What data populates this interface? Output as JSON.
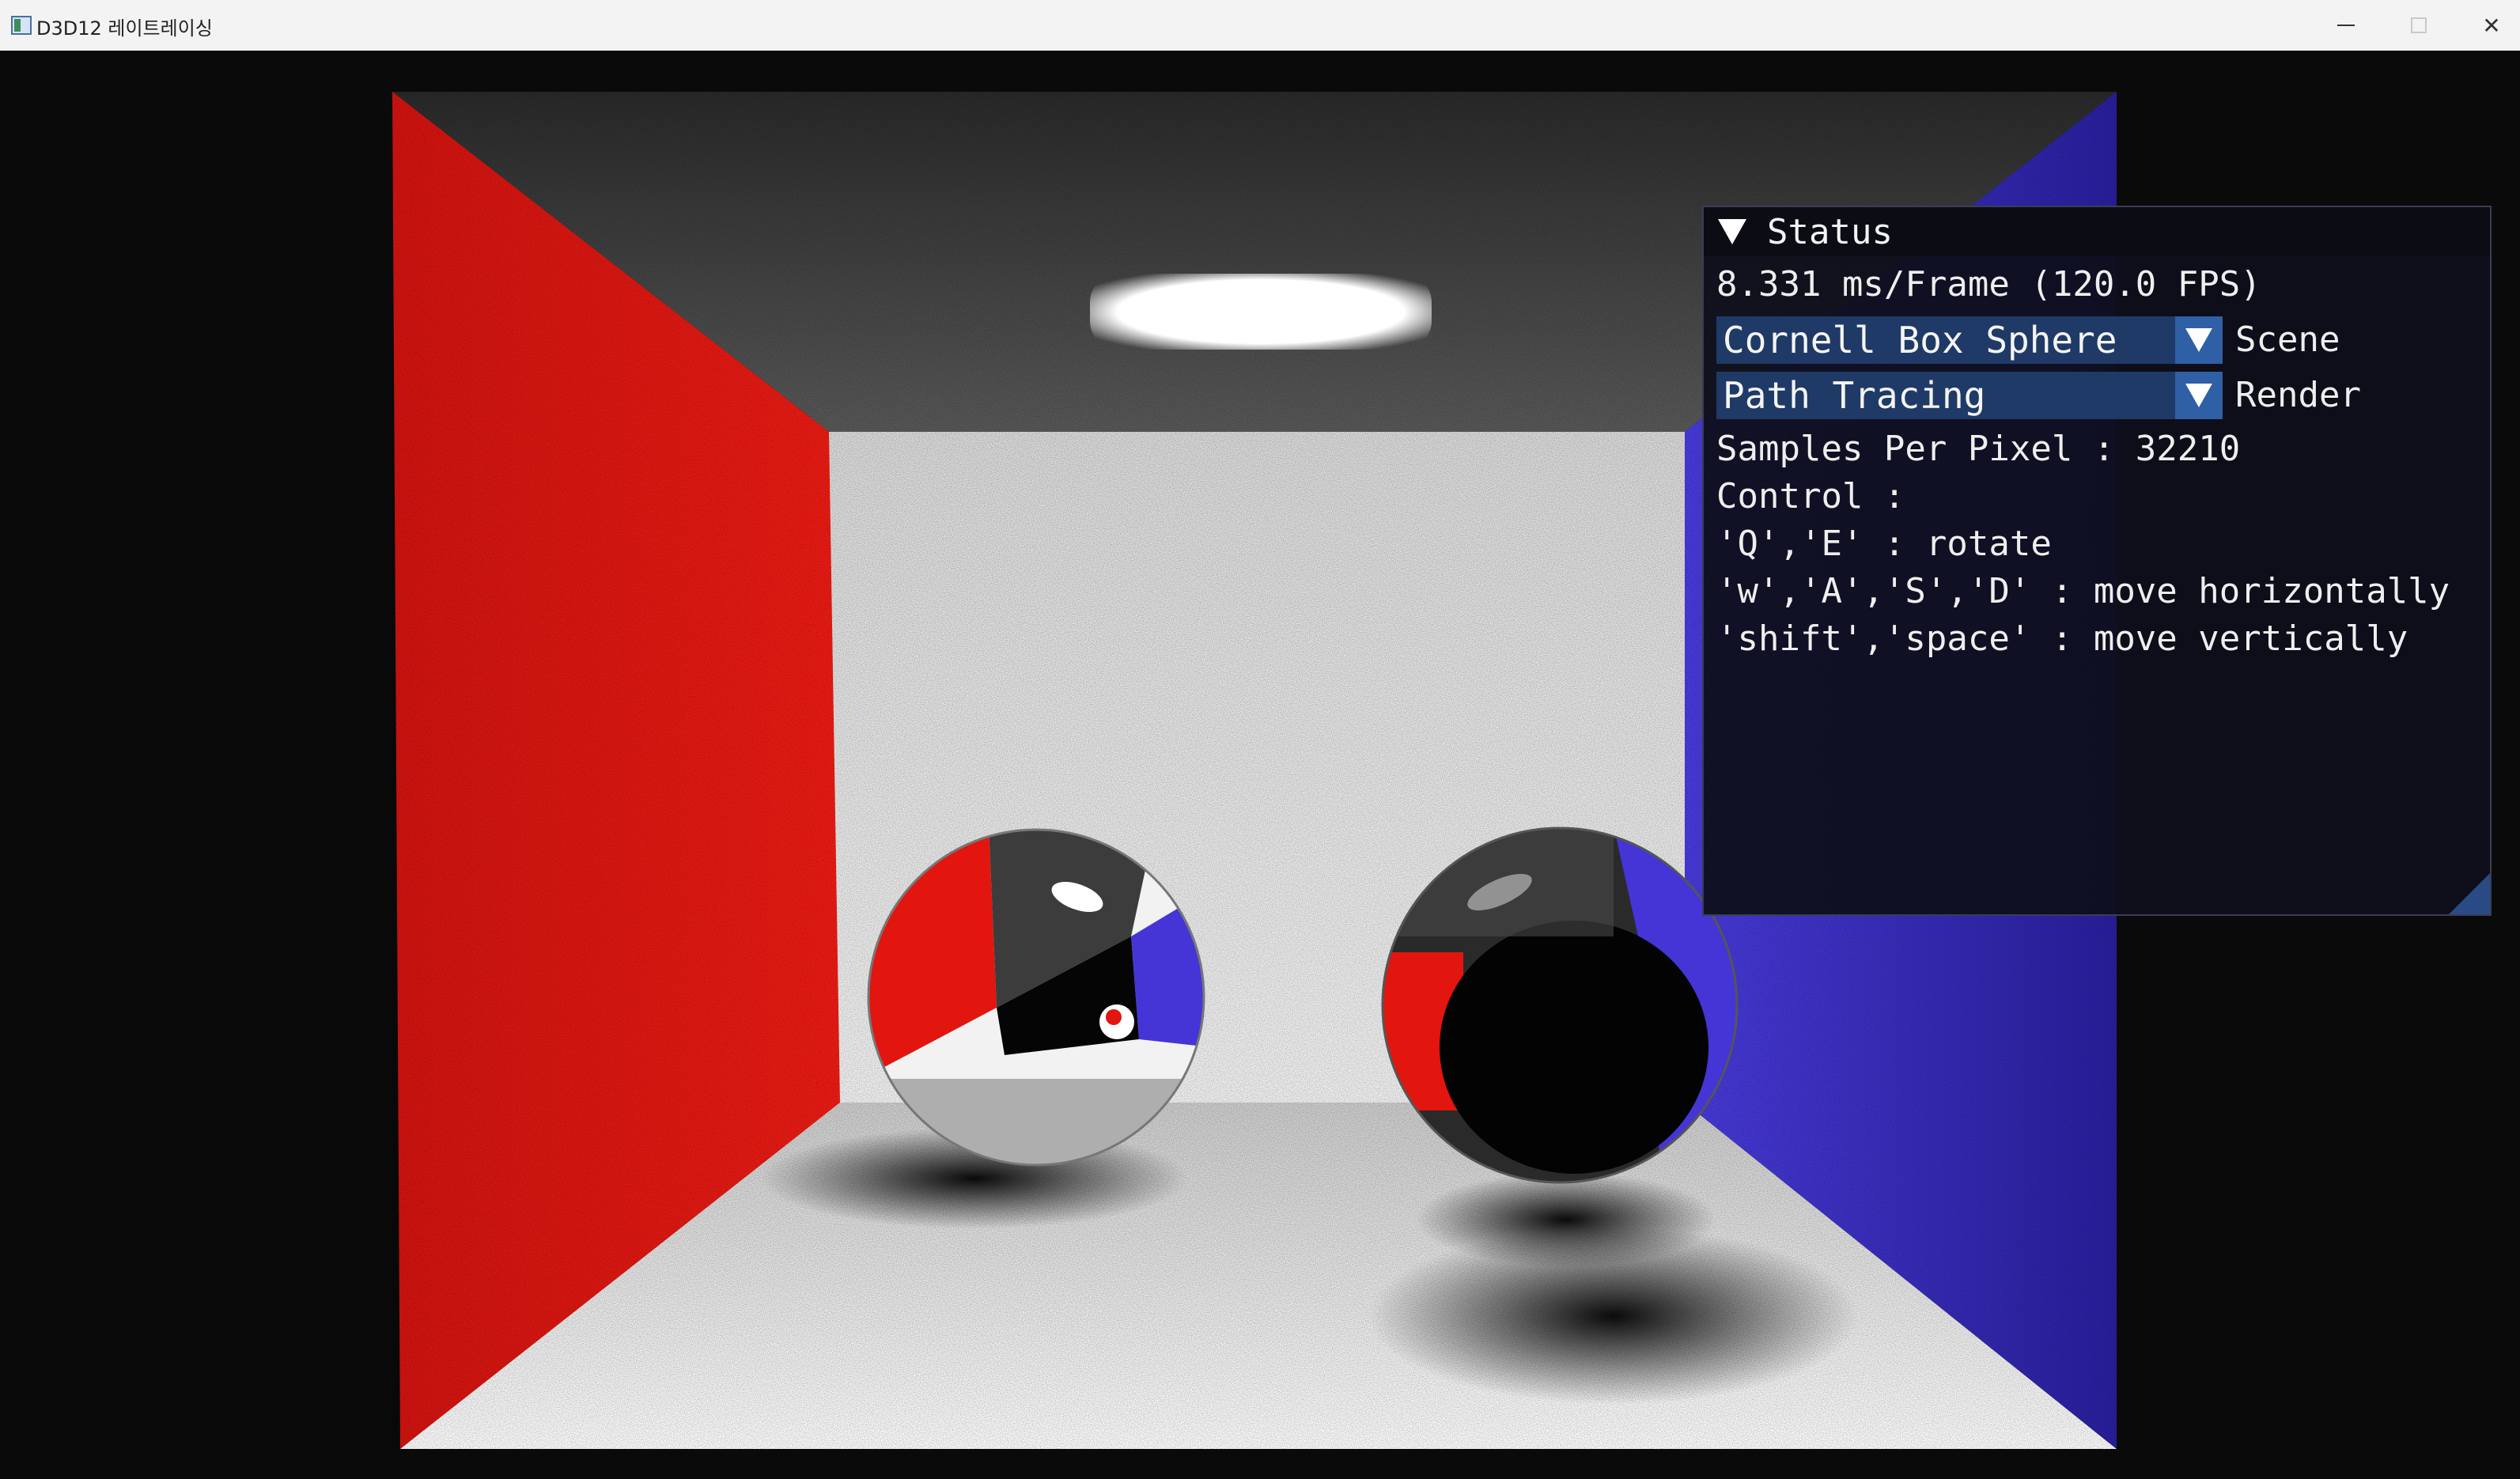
{
  "window": {
    "title": "D3D12 레이트레이싱",
    "minimize_label": "─",
    "close_label": "✕"
  },
  "status_panel": {
    "title": "Status",
    "frame_stats": "8.331 ms/Frame (120.0 FPS)",
    "scene_combo": {
      "value": "Cornell Box Sphere",
      "label": "Scene"
    },
    "render_combo": {
      "value": "Path Tracing",
      "label": "Render"
    },
    "samples_line": "Samples Per Pixel : 32210",
    "controls_header": "Control :",
    "controls": [
      "'Q','E' : rotate",
      "'w','A','S','D' : move horizontally",
      "'shift','space' : move vertically"
    ]
  },
  "colors": {
    "left_wall": "#e11a12",
    "right_wall": "#3c2fc8",
    "combo_bg": "#1f3a66",
    "combo_arrow_bg": "#2f5fa5",
    "panel_bg": "#0e0f1c"
  }
}
